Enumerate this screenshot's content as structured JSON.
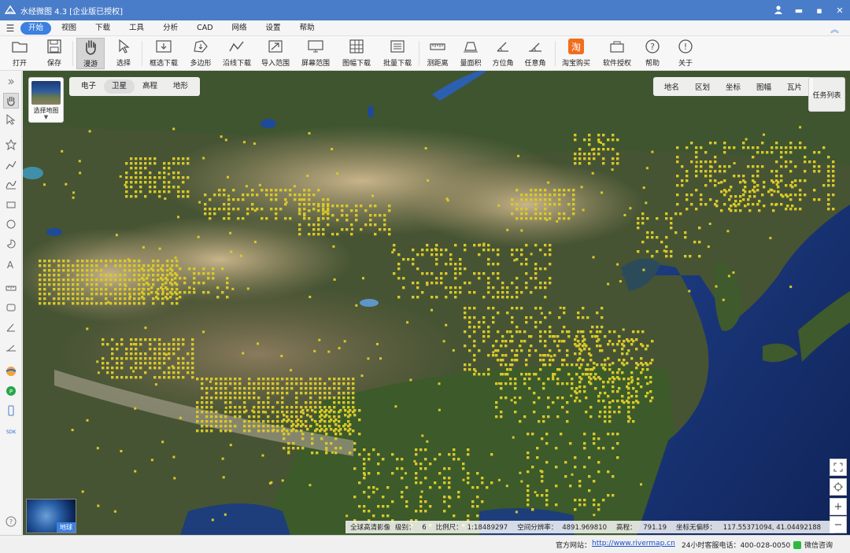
{
  "titlebar": {
    "title": "水经微图 4.3 [企业版已授权]",
    "controls": [
      "user-icon",
      "minimize-icon",
      "restore-icon",
      "close-icon"
    ]
  },
  "menubar": {
    "items": [
      {
        "label": "开始",
        "active": true
      },
      {
        "label": "视图"
      },
      {
        "label": "下载"
      },
      {
        "label": "工具"
      },
      {
        "label": "分析"
      },
      {
        "label": "CAD"
      },
      {
        "label": "网络"
      },
      {
        "label": "设置"
      },
      {
        "label": "帮助"
      }
    ]
  },
  "ribbon": {
    "tools": [
      {
        "label": "打开",
        "icon": "folder-icon"
      },
      {
        "label": "保存",
        "icon": "save-icon"
      },
      {
        "label": "漫游",
        "icon": "hand-icon",
        "selected": true
      },
      {
        "label": "选择",
        "icon": "pointer-icon"
      },
      {
        "label": "框选下载",
        "icon": "rect-download-icon"
      },
      {
        "label": "多边形",
        "icon": "polygon-icon"
      },
      {
        "label": "沿线下载",
        "icon": "polyline-icon"
      },
      {
        "label": "导入范围",
        "icon": "import-icon"
      },
      {
        "label": "屏幕范围",
        "icon": "screen-icon"
      },
      {
        "label": "图幅下载",
        "icon": "grid-icon"
      },
      {
        "label": "批量下载",
        "icon": "batch-icon"
      },
      {
        "label": "测距离",
        "icon": "ruler-icon"
      },
      {
        "label": "量面积",
        "icon": "area-icon"
      },
      {
        "label": "方位角",
        "icon": "azimuth-icon"
      },
      {
        "label": "任意角",
        "icon": "angle-icon"
      },
      {
        "label": "淘宝购买",
        "icon": "taobao-icon"
      },
      {
        "label": "软件授权",
        "icon": "license-icon"
      },
      {
        "label": "帮助",
        "icon": "help-icon"
      },
      {
        "label": "关于",
        "icon": "info-icon"
      }
    ]
  },
  "map": {
    "basemap_label": "选择地图",
    "types": [
      {
        "label": "电子"
      },
      {
        "label": "卫星",
        "active": true
      },
      {
        "label": "高程"
      },
      {
        "label": "地形"
      }
    ],
    "overlays": [
      "地名",
      "区划",
      "坐标",
      "图幅",
      "瓦片"
    ],
    "task_list": "任务列表",
    "earth_label": "地球",
    "zoom_controls": [
      "fullscreen-icon",
      "locate-icon",
      "zoom-in-icon",
      "zoom-out-icon"
    ]
  },
  "status": {
    "source": "全球高清影像",
    "level_label": "级别：",
    "level": "6",
    "scale_label": "比例尺：",
    "scale": "1:18489297",
    "resolution_label": "空间分辨率：",
    "resolution": "4891.969810",
    "elevation_label": "高程：",
    "elevation": "791.19",
    "offset_label": "坐标无偏移：",
    "coords": "117.55371094, 41.04492188"
  },
  "footer": {
    "site_label": "官方网站：",
    "site_url": "http://www.rivermap.cn",
    "phone": "24小时客服电话：400-028-0050",
    "wechat": "微信咨询"
  },
  "colors": {
    "titlebar": "#4a7dc9",
    "accent": "#3c80e0",
    "tile_marker": "#d9c82a"
  }
}
